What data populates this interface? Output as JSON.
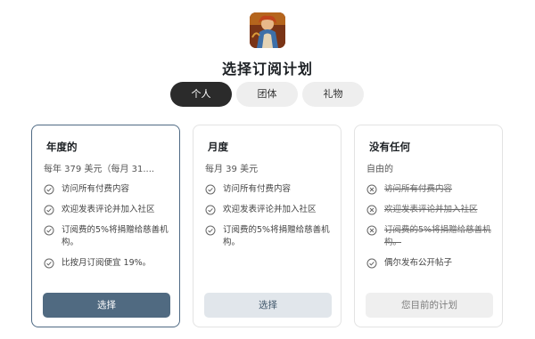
{
  "page": {
    "title": "选择订阅计划"
  },
  "tabs": [
    {
      "label": "个人",
      "active": true
    },
    {
      "label": "团体",
      "active": false
    },
    {
      "label": "礼物",
      "active": false
    }
  ],
  "plans": [
    {
      "title": "年度的",
      "price": "每年 379 美元（每月 31....",
      "features": [
        {
          "text": "访问所有付费内容",
          "included": true
        },
        {
          "text": "欢迎发表评论并加入社区",
          "included": true
        },
        {
          "text": "订阅费的5%将捐赠给慈善机构。",
          "included": true
        },
        {
          "text": "比按月订阅便宜 19%。",
          "included": true
        }
      ],
      "button": "选择",
      "selected": true
    },
    {
      "title": "月度",
      "price": "每月 39 美元",
      "features": [
        {
          "text": "访问所有付费内容",
          "included": true
        },
        {
          "text": "欢迎发表评论并加入社区",
          "included": true
        },
        {
          "text": "订阅费的5%将捐赠给慈善机构。",
          "included": true
        }
      ],
      "button": "选择",
      "selected": false
    },
    {
      "title": "没有任何",
      "price": "自由的",
      "features": [
        {
          "text": "访问所有付费内容",
          "included": false
        },
        {
          "text": "欢迎发表评论并加入社区",
          "included": false
        },
        {
          "text": "订阅费的5%将捐赠给慈善机构。",
          "included": false
        },
        {
          "text": "偶尔发布公开帖子",
          "included": true
        }
      ],
      "button": "您目前的计划",
      "selected": false
    }
  ],
  "colors": {
    "accent": "#506a81",
    "tab_active": "#2b2b2b"
  }
}
